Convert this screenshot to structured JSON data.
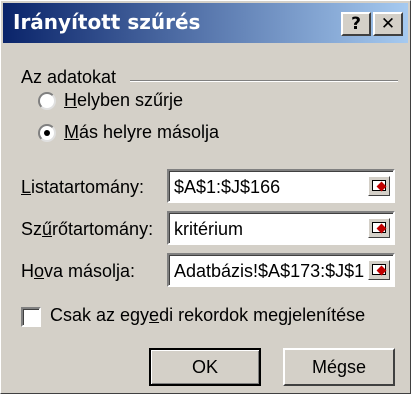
{
  "window": {
    "title": "Irányított szűrés",
    "help_label": "?",
    "close_label": "✕"
  },
  "action_group": {
    "legend": "Az adatokat",
    "options": [
      {
        "label": "Helyben szűrje",
        "mnemonic": "H",
        "rest": "elyben szűrje",
        "selected": false
      },
      {
        "label": "Más helyre másolja",
        "mnemonic": "M",
        "rest": "ás helyre másolja",
        "selected": true
      }
    ]
  },
  "fields": {
    "list_range": {
      "label_pre": "",
      "mnemonic": "L",
      "label_post": "istatartomány:",
      "value": "$A$1:$J$166",
      "icon": "collapse-dialog-icon"
    },
    "criteria_range": {
      "label_pre": "Sz",
      "mnemonic": "ű",
      "label_post": "rőtartomány:",
      "value": "kritérium",
      "icon": "collapse-dialog-icon"
    },
    "copy_to": {
      "label_pre": "H",
      "mnemonic": "o",
      "label_post": "va másolja:",
      "value": "Adatbázis!$A$173:$J$1",
      "icon": "collapse-dialog-icon"
    }
  },
  "unique_records": {
    "label_pre": "Csak az egy",
    "mnemonic": "e",
    "label_post": "di rekordok megjelenítése",
    "checked": false
  },
  "buttons": {
    "ok": "OK",
    "cancel": "Mégse"
  }
}
